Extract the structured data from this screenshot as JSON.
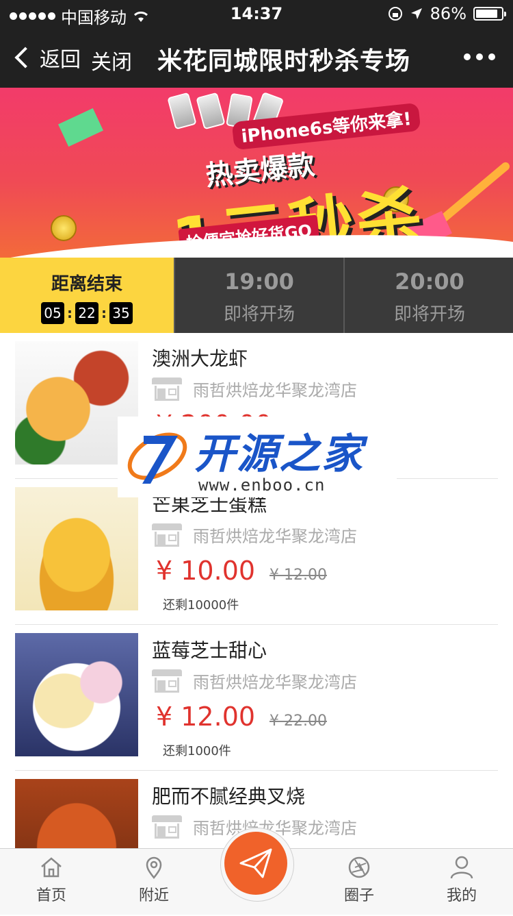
{
  "status_bar": {
    "carrier": "中国移动",
    "time": "14:37",
    "battery": "86%",
    "battery_level": 0.86
  },
  "nav": {
    "back_label": "返回",
    "close_label": "关闭",
    "title": "米花同城限时秒杀专场"
  },
  "banner": {
    "subtitle": "iPhone6s等你来拿!",
    "headline_small": "热卖爆款",
    "headline_big": "1元秒杀",
    "slogan": "捡便宜抢好货GO"
  },
  "tabs": {
    "active": {
      "label": "距离结束",
      "countdown": [
        "05",
        "22",
        "35"
      ]
    },
    "upcoming": [
      {
        "time": "19:00",
        "status": "即将开场"
      },
      {
        "time": "20:00",
        "status": "即将开场"
      }
    ]
  },
  "products": [
    {
      "name": "澳洲大龙虾",
      "shop": "雨哲烘焙龙华聚龙湾店",
      "price": "¥ 200.00",
      "old_price": "",
      "stock": ""
    },
    {
      "name": "芒果芝士蛋糕",
      "shop": "雨哲烘焙龙华聚龙湾店",
      "price": "¥ 10.00",
      "old_price": "¥ 12.00",
      "stock": "还剩10000件"
    },
    {
      "name": "蓝莓芝士甜心",
      "shop": "雨哲烘焙龙华聚龙湾店",
      "price": "¥ 12.00",
      "old_price": "¥ 22.00",
      "stock": "还剩1000件"
    },
    {
      "name": "肥而不腻经典叉烧",
      "shop": "雨哲烘焙龙华聚龙湾店",
      "price": "",
      "old_price": "",
      "stock": ""
    }
  ],
  "watermark": {
    "text": "开源之家",
    "url": "www.enboo.cn"
  },
  "tabbar": {
    "home": "首页",
    "nearby": "附近",
    "circle": "圈子",
    "mine": "我的"
  },
  "colors": {
    "accent": "#f0622a",
    "price": "#e0332e",
    "active_tab": "#fcd540",
    "nav_bg": "#212121"
  }
}
